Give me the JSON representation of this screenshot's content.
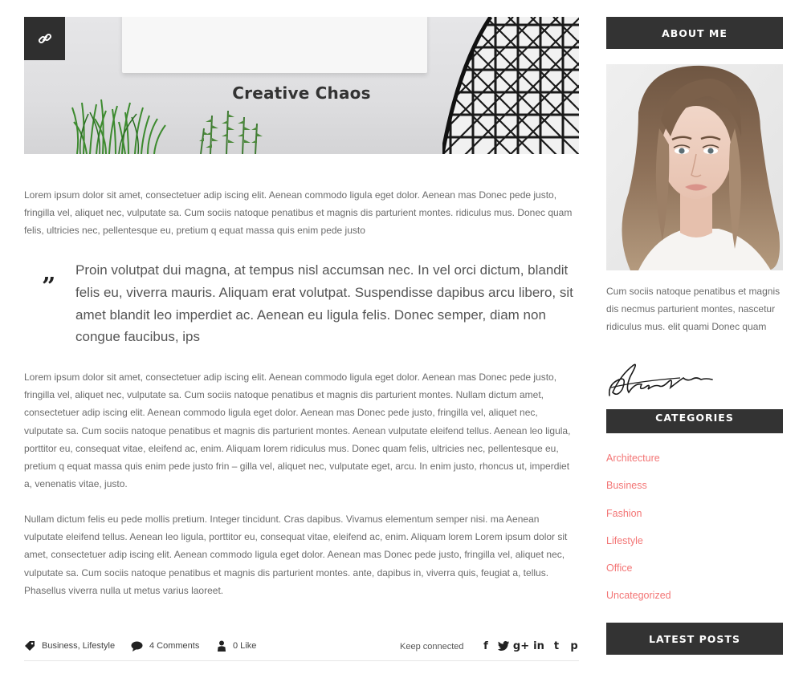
{
  "post": {
    "title": "Creative Chaos",
    "paragraph_1": "Lorem ipsum dolor sit amet, consectetuer adip iscing elit. Aenean commodo ligula eget dolor. Aenean mas Donec pede justo, fringilla vel, aliquet nec, vulputate sa. Cum sociis natoque penatibus et magnis dis parturient montes. ridiculus mus. Donec quam felis, ultricies nec, pellentesque eu, pretium q equat massa quis enim pede justo",
    "quote": "Proin volutpat dui magna, at tempus nisl accumsan nec. In vel orci dictum, blandit felis eu, viverra mauris. Aliquam erat volutpat. Suspendisse dapibus arcu libero, sit amet blandit leo imperdiet ac. Aenean eu ligula felis. Donec semper, diam non congue faucibus, ips",
    "quote_mark": "”",
    "paragraph_2": "Lorem ipsum dolor sit amet, consectetuer adip iscing elit. Aenean commodo ligula eget dolor. Aenean mas Donec pede justo, fringilla vel, aliquet nec, vulputate sa. Cum sociis natoque penatibus et magnis dis parturient montes. Nullam dictum amet, consectetuer adip iscing elit. Aenean commodo ligula eget dolor. Aenean mas Donec pede justo, fringilla vel, aliquet nec, vulputate sa. Cum sociis natoque penatibus et magnis dis parturient montes. Aenean vulputate eleifend tellus. Aenean leo ligula, porttitor eu, consequat vitae, eleifend ac, enim. Aliquam lorem ridiculus mus. Donec quam felis, ultricies nec, pellentesque eu, pretium q equat massa quis enim pede justo frin – gilla vel, aliquet nec, vulputate eget, arcu. In enim justo, rhoncus ut, imperdiet a, venenatis vitae, justo.",
    "paragraph_3": "Nullam dictum felis eu pede mollis pretium. Integer tincidunt. Cras dapibus. Vivamus elementum semper nisi. ma Aenean vulputate eleifend tellus. Aenean leo ligula, porttitor eu, consequat vitae, eleifend ac, enim. Aliquam lorem Lorem ipsum dolor sit amet, consectetuer adip iscing elit. Aenean commodo ligula eget dolor. Aenean mas Donec pede justo, fringilla vel, aliquet nec, vulputate sa. Cum sociis natoque penatibus et magnis dis parturient montes. ante, dapibus in, viverra quis, feugiat a, tellus. Phasellus viverra nulla ut metus varius laoreet.",
    "meta": {
      "tags": "Business, Lifestyle",
      "comments": "4 Comments",
      "likes": "0 Like",
      "keep_connected": "Keep connected"
    },
    "social": [
      {
        "name": "facebook-icon",
        "glyph": "f"
      },
      {
        "name": "twitter-icon",
        "glyph": "t"
      },
      {
        "name": "google-plus-icon",
        "glyph": "g+"
      },
      {
        "name": "linkedin-icon",
        "glyph": "in"
      },
      {
        "name": "tumblr-icon",
        "glyph": "t"
      },
      {
        "name": "pinterest-icon",
        "glyph": "p"
      }
    ]
  },
  "sidebar": {
    "about_title": "ABOUT ME",
    "about_text": "Cum sociis natoque penatibus et magnis dis necmus parturient montes, nascetur ridiculus mus. elit quami Donec quam",
    "categories_title": "CATEGORIES",
    "categories": [
      "Architecture",
      "Business",
      "Fashion",
      "Lifestyle",
      "Office",
      "Uncategorized"
    ],
    "latest_title": "LATEST POSTS"
  },
  "colors": {
    "accent": "#f37575",
    "dark": "#333333",
    "text": "#6b6b6b"
  }
}
